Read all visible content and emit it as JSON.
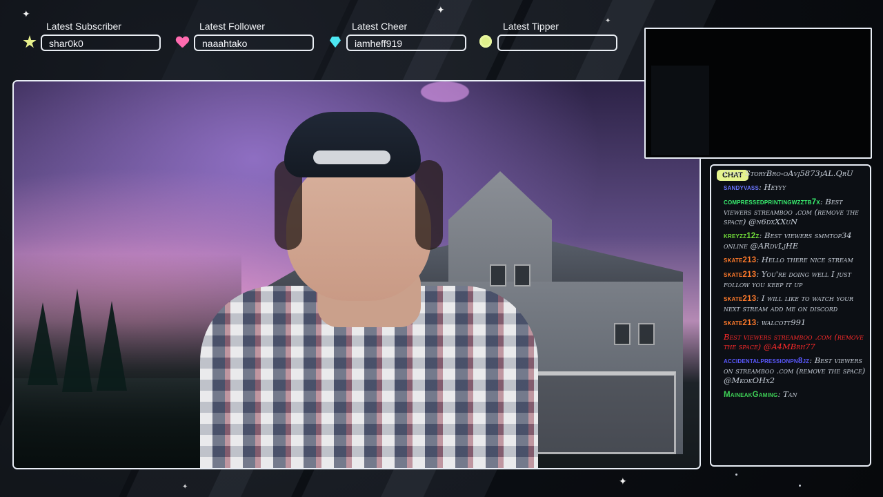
{
  "widgets": [
    {
      "label": "Latest Subscriber",
      "value": "shar0k0",
      "icon": "star-icon",
      "icon_color": "#e7f08c"
    },
    {
      "label": "Latest Follower",
      "value": "naaahtako",
      "icon": "heart-icon",
      "icon_color": "#ff6bb0"
    },
    {
      "label": "Latest Cheer",
      "value": "iamheff919",
      "icon": "diamond-icon",
      "icon_color": "#4de7f2"
    },
    {
      "label": "Latest Tipper",
      "value": "",
      "icon": "coin-icon",
      "icon_color": "#dff08b"
    }
  ],
  "chat": {
    "title": "CHAT",
    "messages": [
      {
        "user": "",
        "text": "Cool StoryBro-oAvj5873jAL.QrU",
        "user_color": "#c8cfd9"
      },
      {
        "user": "sandyvass",
        "text": "Heyyy",
        "user_color": "#6b76ff"
      },
      {
        "user": "compressedprintingwzztb7x",
        "text": "Best viewers streamboo .com (remove the space) @n6dxXXuN",
        "user_color": "#39f06f"
      },
      {
        "user": "kreyzz12z",
        "text": "Best viewers smmtop34 online @ARdvLjHE",
        "user_color": "#73df3a"
      },
      {
        "user": "skate213",
        "text": "Hello there nice stream",
        "user_color": "#ff7a2b"
      },
      {
        "user": "skate213",
        "text": "You're doing well I just follow you keep it up",
        "user_color": "#ff7a2b"
      },
      {
        "user": "skate213",
        "text": "I will like to watch your next stream add me on discord",
        "user_color": "#ff7a2b"
      },
      {
        "user": "skate213",
        "text": "walcott991",
        "user_color": "#ff7a2b"
      },
      {
        "user": "",
        "text": "Best viewers streamboo .com (remove the space) @A4MBrh77",
        "user_color": "#ff2a2a"
      },
      {
        "user": "accidentalpressionpn8jz",
        "text": "Best viewers on streamboo .com (remove the space) @MkokOHx2",
        "user_color": "#5a58ff"
      },
      {
        "user": "MaineakGaming",
        "text": "Tan",
        "user_color": "#3ecf56"
      }
    ]
  },
  "colors": {
    "frame": "#e9eef6",
    "background": "#0b0e13",
    "chat_pill": "#e5f48e"
  }
}
